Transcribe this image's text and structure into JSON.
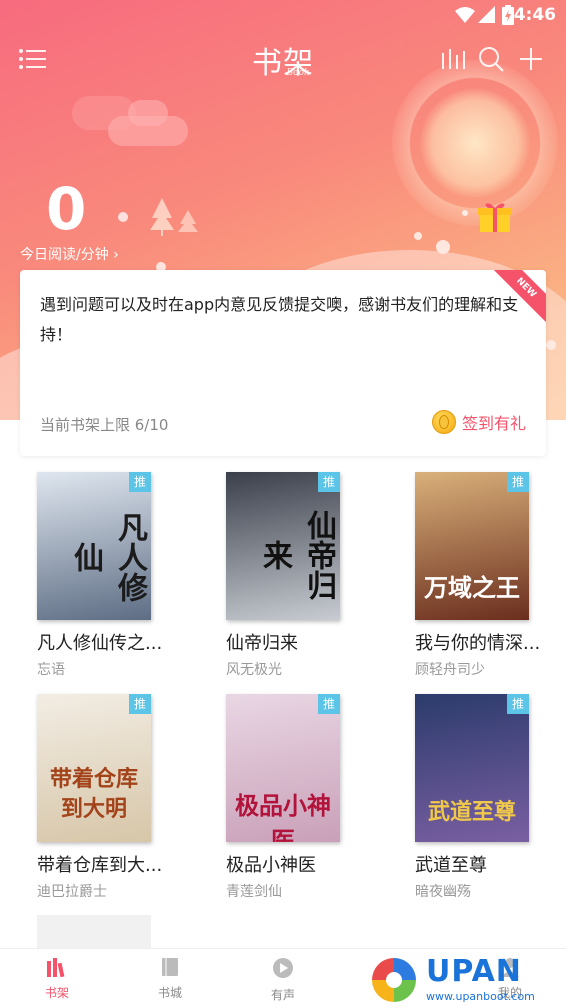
{
  "status_bar": {
    "time": "4:46"
  },
  "header": {
    "title": "书架",
    "subtitle": "Book"
  },
  "reading": {
    "minutes": "0",
    "label": "今日阅读/分钟 ›"
  },
  "notice": {
    "message": "遇到问题可以及时在app内意见反馈提交噢，感谢书友们的理解和支持！",
    "badge": "NEW",
    "shelf_limit": "当前书架上限 6/10",
    "sign_in": "签到有礼"
  },
  "books": [
    {
      "title": "凡人修仙传之...",
      "author": "忘语",
      "tag": "推",
      "cover_text": "凡人修仙",
      "cover_colors": [
        "#dfe6ef",
        "#5d6d84"
      ]
    },
    {
      "title": "仙帝归来",
      "author": "风无极光",
      "tag": "推",
      "cover_text": "仙帝归来",
      "cover_colors": [
        "#3a3f4a",
        "#c8ccd2"
      ]
    },
    {
      "title": "我与你的情深...",
      "author": "顾轻舟司少",
      "tag": "推",
      "cover_text": "万域之王",
      "cover_colors": [
        "#d9b07a",
        "#6b2e1e"
      ]
    },
    {
      "title": "带着仓库到大...",
      "author": "迪巴拉爵士",
      "tag": "推",
      "cover_text": "带着仓库到大明",
      "cover_colors": [
        "#f2ede4",
        "#d7c6a8"
      ]
    },
    {
      "title": "极品小神医",
      "author": "青莲剑仙",
      "tag": "推",
      "cover_text": "极品小神医",
      "cover_colors": [
        "#e9d7e4",
        "#c9a0b8"
      ]
    },
    {
      "title": "武道至尊",
      "author": "暗夜幽殇",
      "tag": "推",
      "cover_text": "武道至尊",
      "cover_colors": [
        "#2b3b6b",
        "#7a5fa3"
      ]
    }
  ],
  "bottom_nav": [
    {
      "label": "书架",
      "icon": "bookshelf-icon",
      "active": true
    },
    {
      "label": "书城",
      "icon": "book-icon",
      "active": false
    },
    {
      "label": "有声",
      "icon": "play-icon",
      "active": false
    },
    {
      "label": "我的",
      "icon": "user-icon",
      "active": false
    }
  ],
  "watermark": {
    "brand": "UPAN",
    "url": "www.upanboot.com"
  },
  "colors": {
    "accent": "#f4536a",
    "tag_blue": "#5bc4e7",
    "gradient_start": "#f76b7e",
    "gradient_end": "#fcc68c"
  }
}
